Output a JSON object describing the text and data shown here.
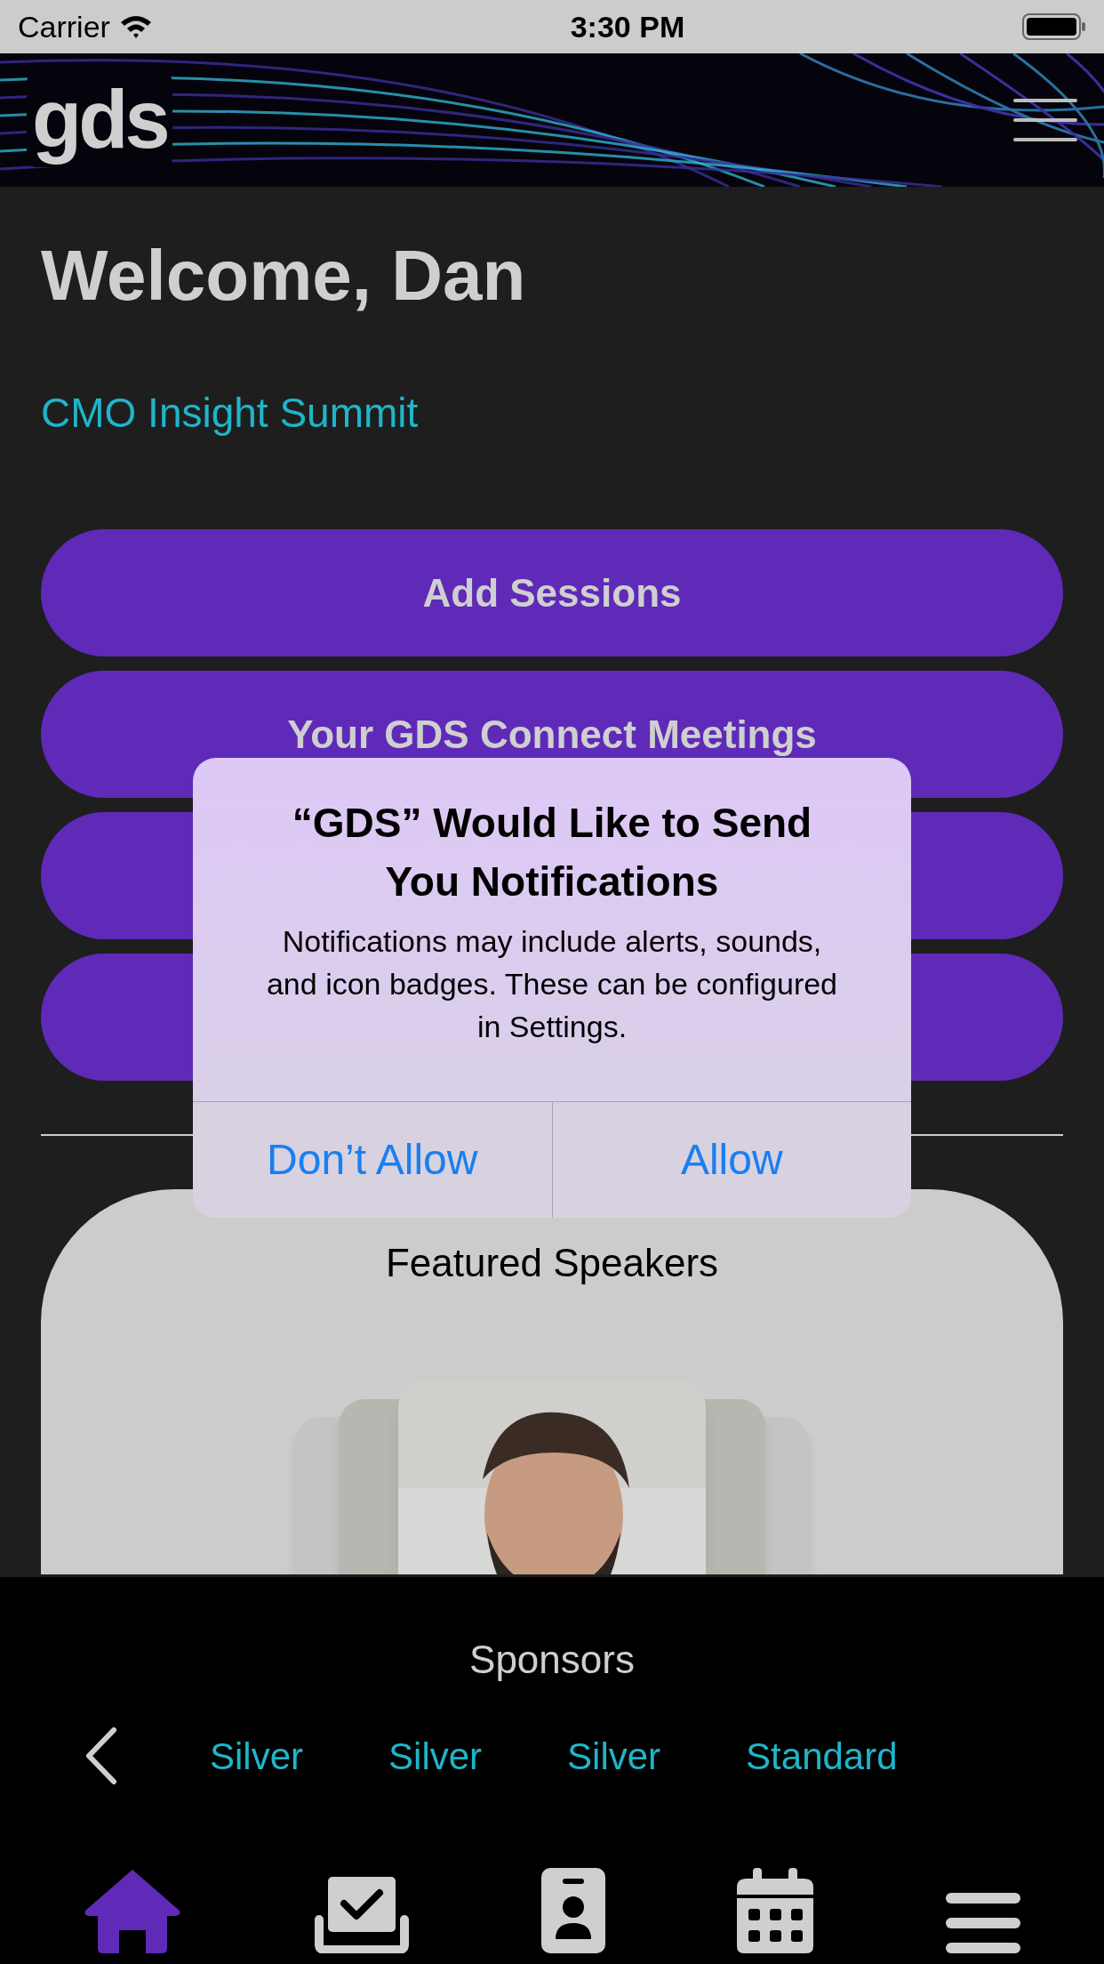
{
  "status_bar": {
    "carrier": "Carrier",
    "time": "3:30 PM"
  },
  "header": {
    "logo": "gds"
  },
  "welcome": "Welcome, Dan",
  "event": "CMO Insight Summit",
  "actions": [
    {
      "kind": "labeled",
      "label": "Add Sessions"
    },
    {
      "kind": "labeled",
      "label": "Your GDS Connect Meetings"
    },
    {
      "kind": "covered"
    },
    {
      "kind": "covered"
    }
  ],
  "featured": {
    "title": "Featured Speakers"
  },
  "dialog": {
    "title": "“GDS” Would Like to Send You Notifications",
    "message": "Notifications may include alerts, sounds, and icon badges. These can be configured in Settings.",
    "buttons": [
      "Don’t Allow",
      "Allow"
    ]
  },
  "sponsors": {
    "title": "Sponsors",
    "tiers": [
      "Silver",
      "Silver",
      "Silver",
      "Standard"
    ]
  },
  "tab_bar": [
    {
      "kind": "home",
      "selected": true
    },
    {
      "kind": "checkin",
      "selected": false
    },
    {
      "kind": "badge",
      "selected": false
    },
    {
      "kind": "calendar",
      "selected": false
    },
    {
      "kind": "menu",
      "selected": false
    }
  ]
}
